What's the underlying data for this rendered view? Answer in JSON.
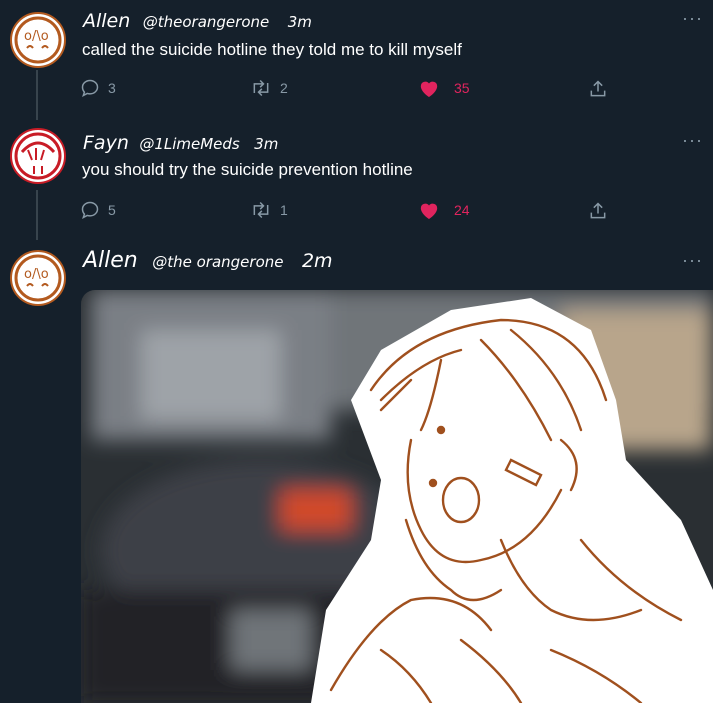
{
  "tweets": [
    {
      "name": "Allen",
      "handle": "@theorangerone",
      "time": "3m",
      "text": "called the suicide hotline they told me to kill myself",
      "replies": "3",
      "retweets": "2",
      "likes": "35",
      "liked": true
    },
    {
      "name": "Fayn",
      "handle": "@1LimeMeds",
      "time": "3m",
      "text": "you should try the suicide prevention hotline",
      "replies": "5",
      "retweets": "1",
      "likes": "24",
      "liked": true
    },
    {
      "name": "Allen",
      "handle": "@the orangerone",
      "time": "2m",
      "text": ""
    }
  ],
  "icons": {
    "reply": "reply-icon",
    "retweet": "retweet-icon",
    "like": "heart-icon",
    "share": "share-icon",
    "more": "more-icon"
  },
  "colors": {
    "background": "#15202b",
    "muted": "#8899a6",
    "like": "#e0245e",
    "avatar_orange": "#b35a1f",
    "avatar_red": "#c81c26"
  }
}
